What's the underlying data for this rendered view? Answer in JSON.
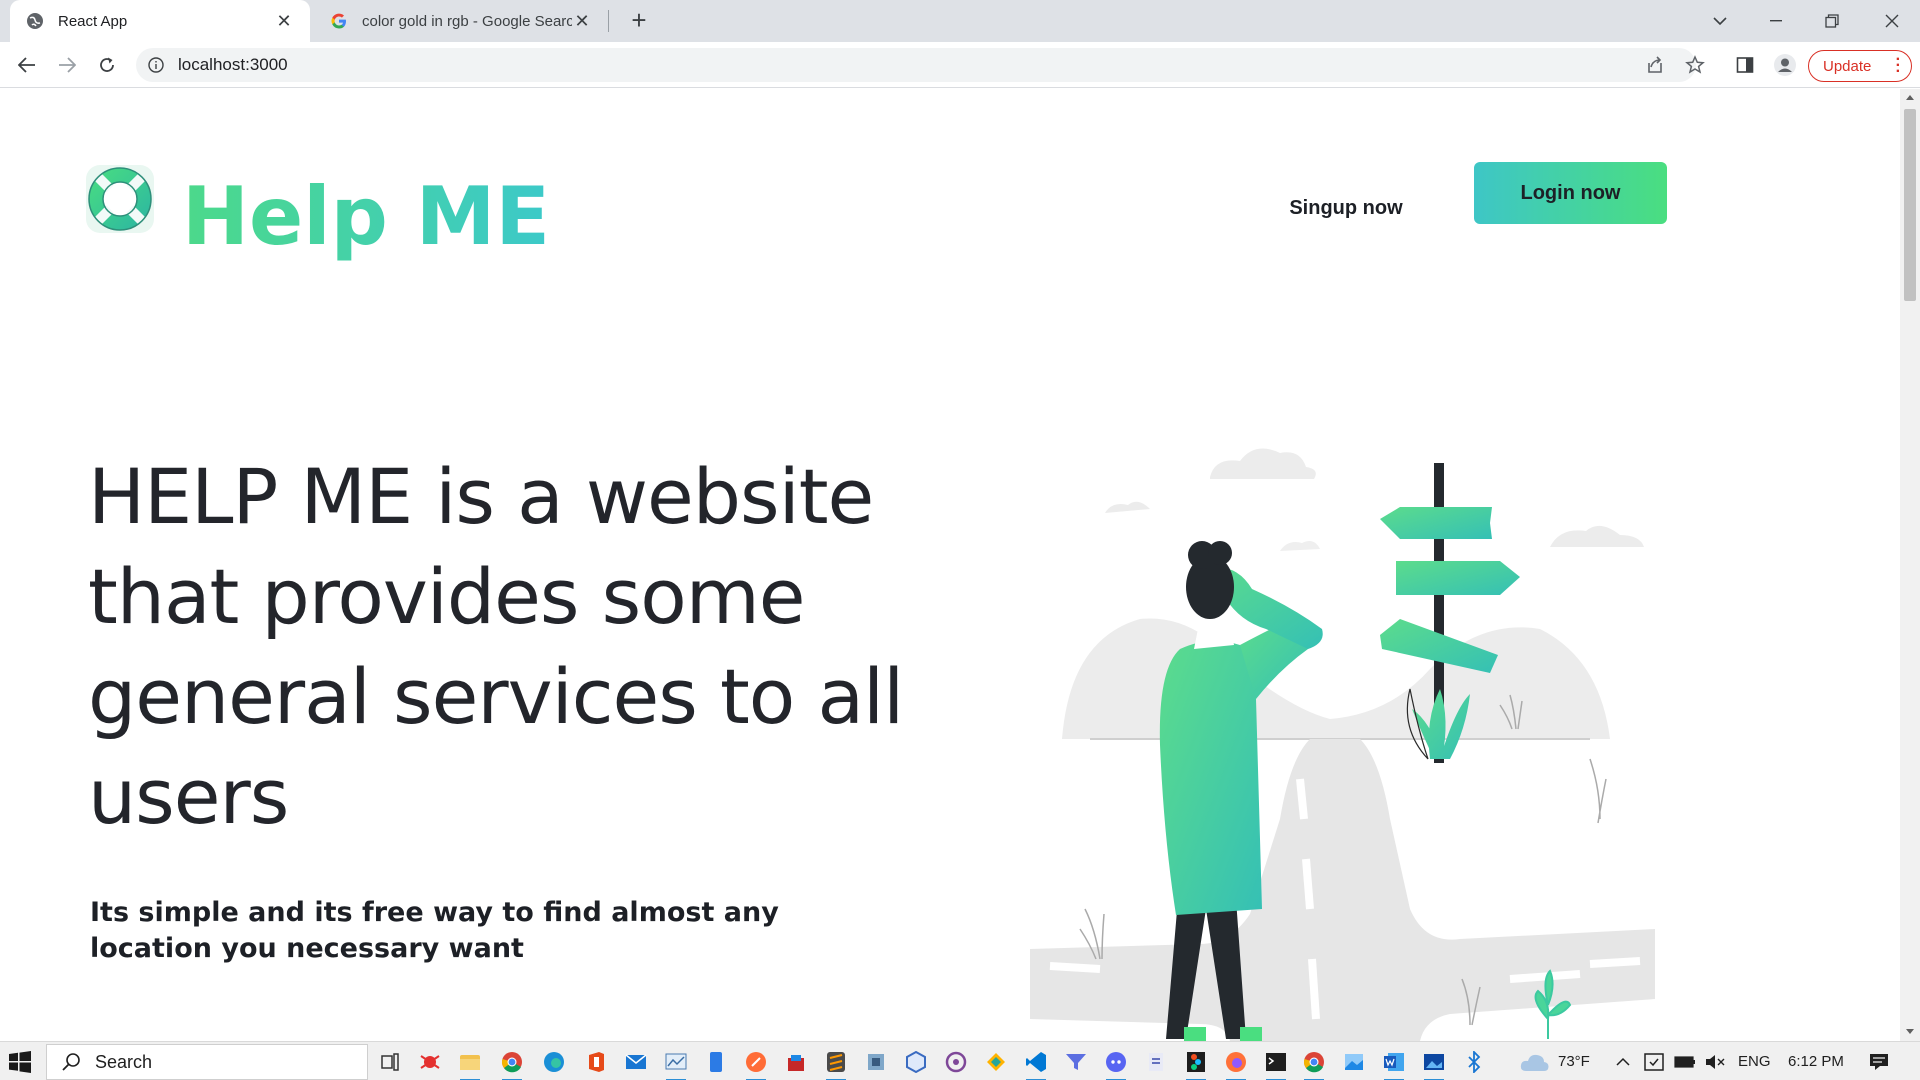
{
  "browser": {
    "tabs": [
      {
        "title": "React App",
        "active": true
      },
      {
        "title": "color gold in rgb - Google Search",
        "active": false
      }
    ],
    "url": "localhost:3000",
    "update_label": "Update"
  },
  "page": {
    "brand": "Help ME",
    "nav": {
      "signup_label": "Singup now",
      "login_label": "Login now"
    },
    "hero": {
      "title": "HELP ME is a website that provides some general services to all users",
      "subtitle": "Its simple and its free way to find almost any location you necessary want"
    }
  },
  "taskbar": {
    "search_placeholder": "Search",
    "weather": "73°F",
    "language": "ENG",
    "time": "6:12 PM"
  },
  "colors": {
    "accent_green": "#4ade80",
    "accent_teal": "#3ec6c6",
    "text_dark": "#23252b",
    "update_red": "#d93025"
  }
}
